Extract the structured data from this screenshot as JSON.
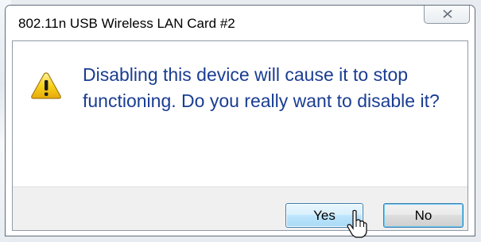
{
  "window": {
    "title": "802.11n USB Wireless LAN Card #2",
    "close_icon": "close-x-icon"
  },
  "message": {
    "icon": "warning-icon",
    "text": "Disabling this device will cause it to stop functioning. Do you really want to disable it?"
  },
  "buttons": {
    "yes_label": "Yes",
    "no_label": "No"
  },
  "colors": {
    "message_text": "#1a3d92",
    "footer_bg": "#f0f0f0",
    "warning_fill": "#f8d21c"
  }
}
